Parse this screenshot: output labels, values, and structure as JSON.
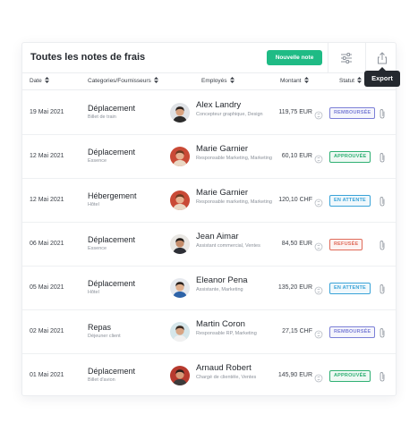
{
  "header": {
    "title": "Toutes les notes de frais",
    "new_button": "Nouvelle note",
    "filter_icon": "sliders-icon",
    "export_icon": "share-export-icon",
    "tooltip": "Export"
  },
  "columns": {
    "date": "Date",
    "category": "Categories/Fournisseurs",
    "employee": "Employés",
    "amount": "Montant",
    "status": "Statut"
  },
  "status_colors": {
    "remboursee": "#7b7fd6",
    "approuvee": "#2fb073",
    "en_attente": "#3aa3d8",
    "refusee": "#e06b5a"
  },
  "rows": [
    {
      "date": "19 Mai 2021",
      "category": "Déplacement",
      "sub": "Billet de train",
      "name": "Alex Landry",
      "role": "Concepteur graphique, Design",
      "amount": "119,75 EUR",
      "status": "REMBOURSÉE",
      "status_key": "remboursee",
      "avatar_bg": "#dfe2e6",
      "skin": "#d9a27f",
      "hair": "#2a221d",
      "shirt": "#2b2b2b"
    },
    {
      "date": "12 Mai 2021",
      "category": "Déplacement",
      "sub": "Essence",
      "name": "Marie Garnier",
      "role": "Responsable Marketing, Marketing",
      "amount": "60,10 EUR",
      "status": "APPROUVÉE",
      "status_key": "approuvee",
      "avatar_bg": "#c94a36",
      "skin": "#e6b191",
      "hair": "#6b3b22",
      "shirt": "#e9d8c4"
    },
    {
      "date": "12 Mai 2021",
      "category": "Hébergement",
      "sub": "Hôtel",
      "name": "Marie Garnier",
      "role": "Responsable marketing, Marketing",
      "amount": "120,10 CHF",
      "status": "EN ATTENTE",
      "status_key": "en_attente",
      "avatar_bg": "#c94a36",
      "skin": "#e6b191",
      "hair": "#6b3b22",
      "shirt": "#e9d8c4"
    },
    {
      "date": "06 Mai 2021",
      "category": "Déplacement",
      "sub": "Essence",
      "name": "Jean Aimar",
      "role": "Assistant commercial, Ventes",
      "amount": "84,50 EUR",
      "status": "REFUSÉE",
      "status_key": "refusee",
      "avatar_bg": "#e9e7e3",
      "skin": "#c48c6a",
      "hair": "#1f1a17",
      "shirt": "#2d2f36"
    },
    {
      "date": "05 Mai 2021",
      "category": "Déplacement",
      "sub": "Hôtel",
      "name": "Eleanor Pena",
      "role": "Assistante, Marketing",
      "amount": "135,20 EUR",
      "status": "EN ATTENTE",
      "status_key": "en_attente",
      "avatar_bg": "#e6e9ee",
      "skin": "#e0b08f",
      "hair": "#2a211d",
      "shirt": "#2d63a8"
    },
    {
      "date": "02 Mai 2021",
      "category": "Repas",
      "sub": "Déjeuner client",
      "name": "Martin Coron",
      "role": "Responsable RP, Marketing",
      "amount": "27,15 CHF",
      "status": "REMBOURSÉE",
      "status_key": "remboursee",
      "avatar_bg": "#d5e6ea",
      "skin": "#d8a584",
      "hair": "#3a2a20",
      "shirt": "#f1f1f1"
    },
    {
      "date": "01 Mai 2021",
      "category": "Déplacement",
      "sub": "Billet d'avion",
      "name": "Arnaud Robert",
      "role": "Chargé de clientèle, Ventes",
      "amount": "145,90 EUR",
      "status": "APPROUVÉE",
      "status_key": "approuvee",
      "avatar_bg": "#b73a2e",
      "skin": "#d79a78",
      "hair": "#2a1f1a",
      "shirt": "#3b3b3b"
    }
  ]
}
